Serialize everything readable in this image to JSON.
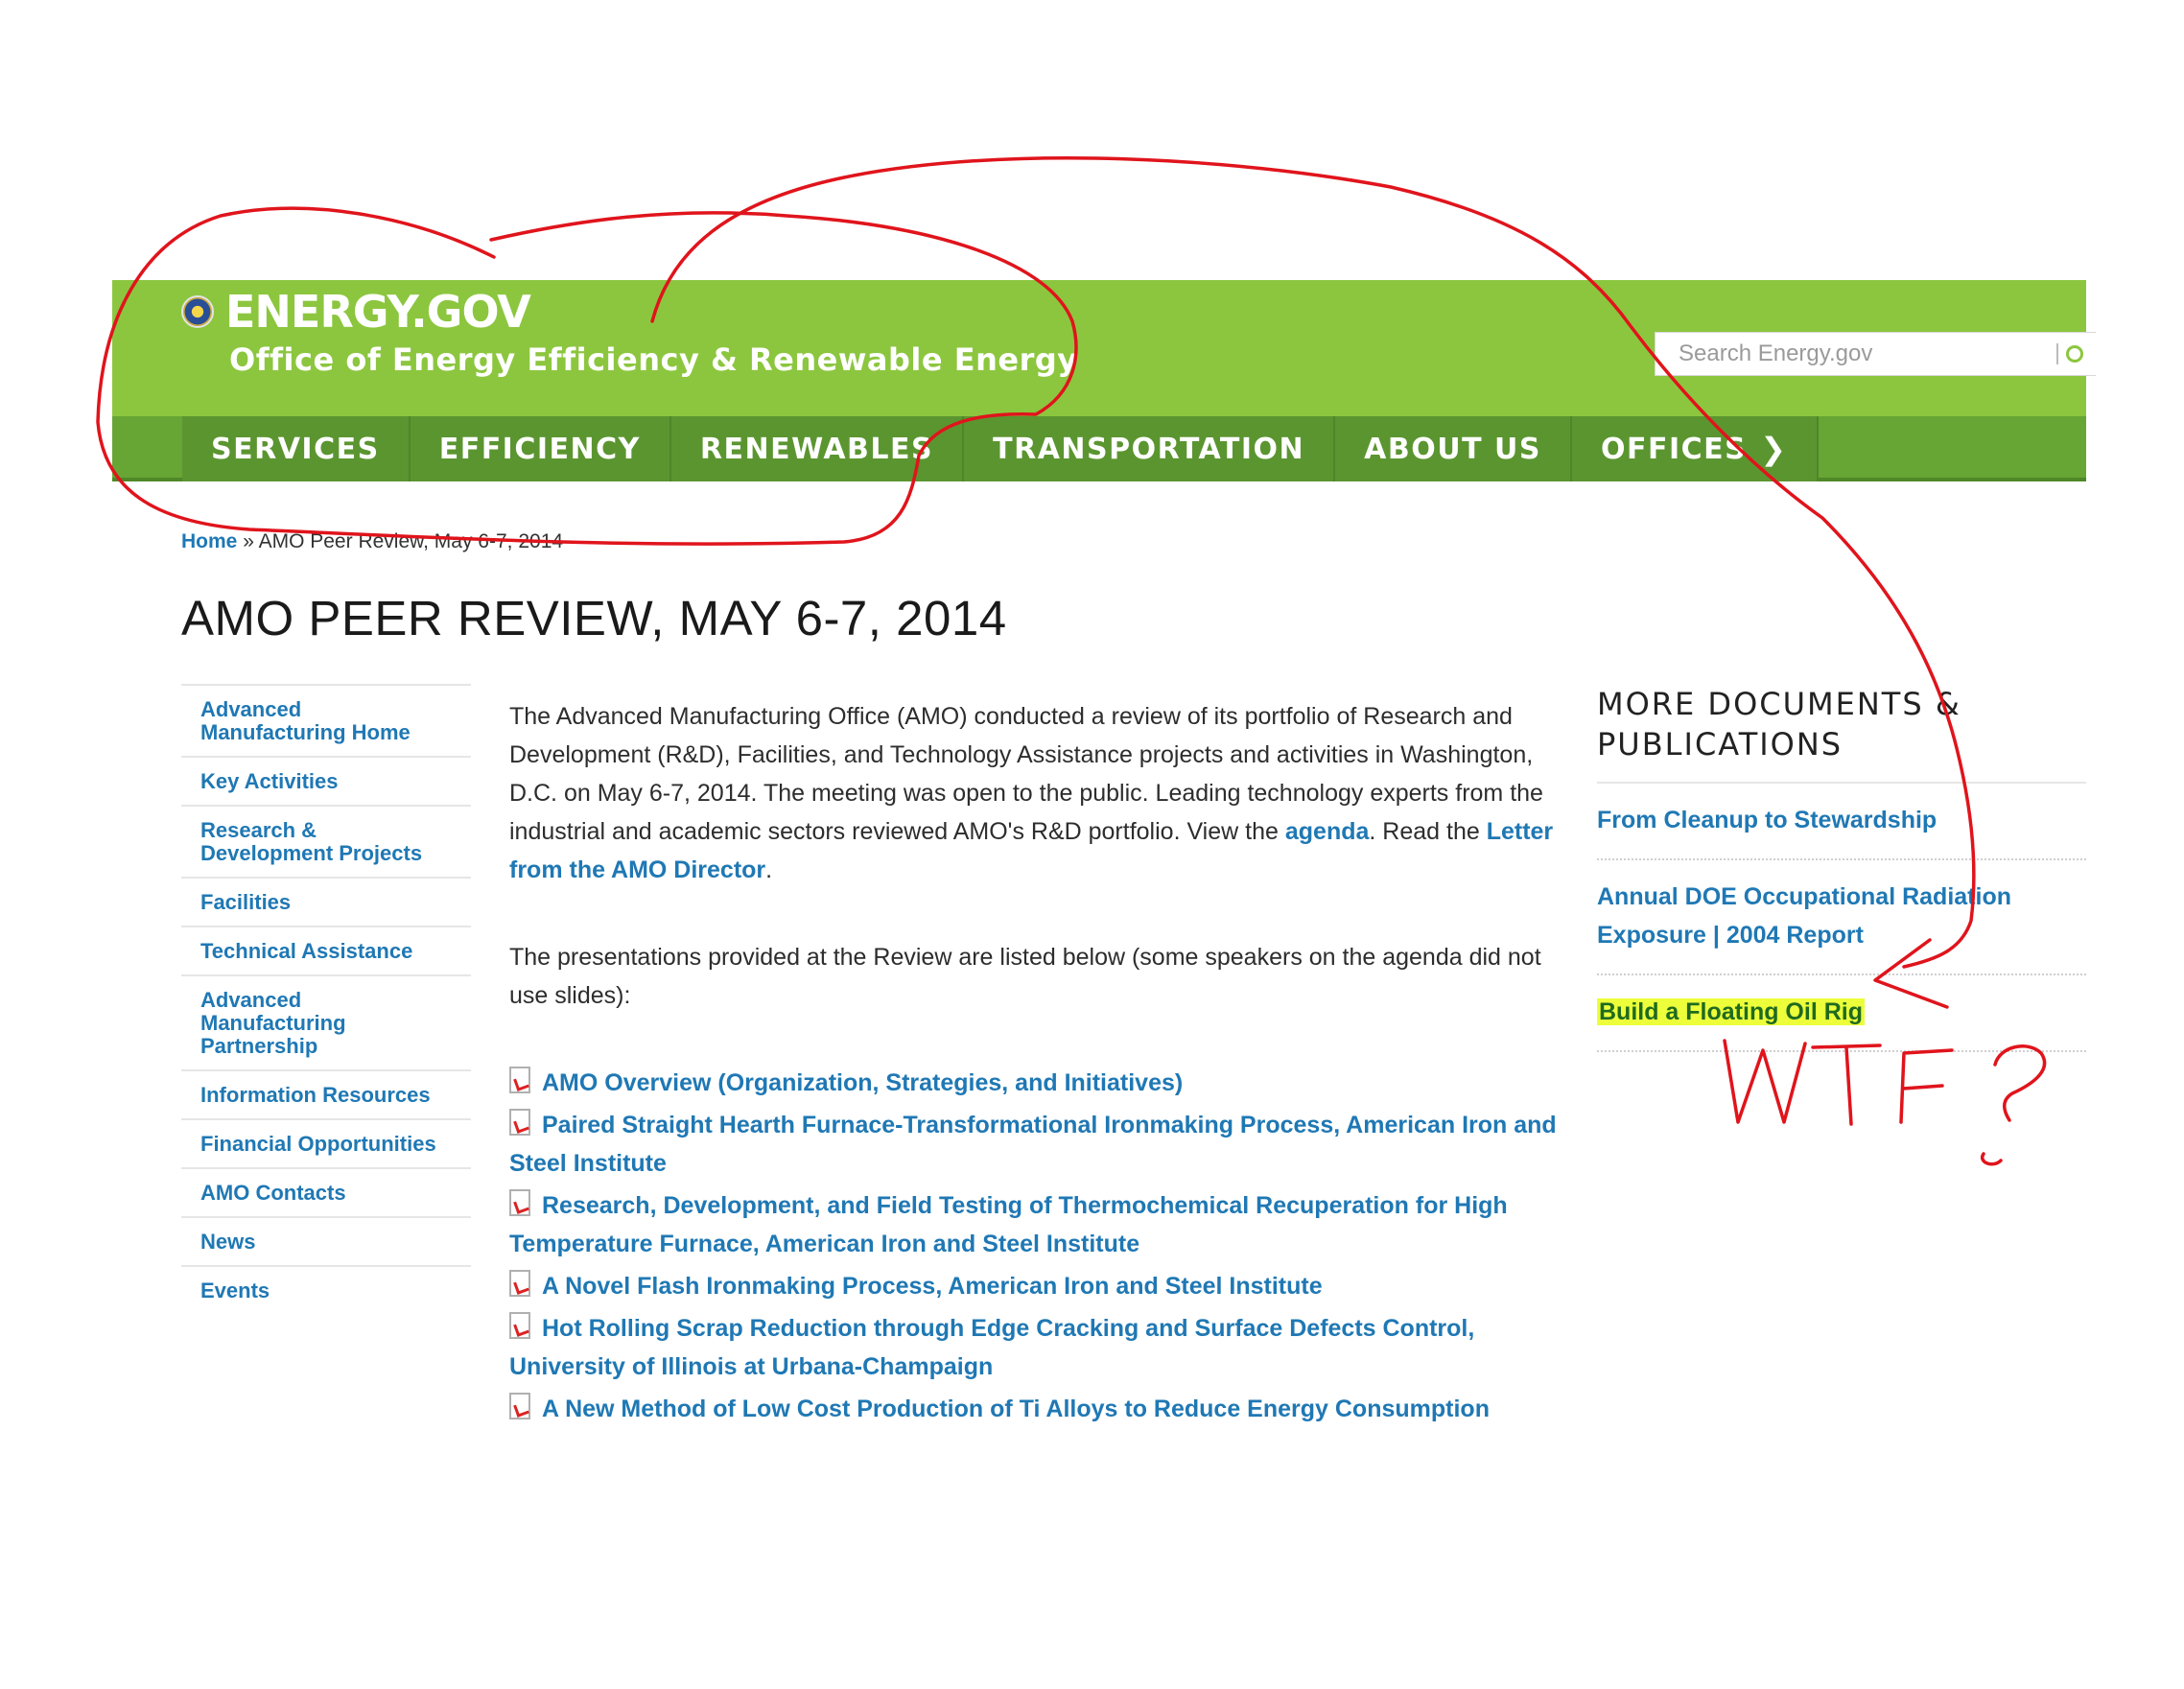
{
  "header": {
    "logo": "ENERGY.GOV",
    "subtitle": "Office of Energy Efficiency & Renewable Energy",
    "search_placeholder": "Search Energy.gov"
  },
  "nav": {
    "items": [
      {
        "label": "SERVICES"
      },
      {
        "label": "EFFICIENCY"
      },
      {
        "label": "RENEWABLES"
      },
      {
        "label": "TRANSPORTATION"
      },
      {
        "label": "ABOUT US"
      },
      {
        "label": "OFFICES"
      }
    ]
  },
  "breadcrumb": {
    "home": "Home",
    "separator": "»",
    "current": "AMO Peer Review, May 6-7, 2014"
  },
  "page_title": "AMO PEER REVIEW, MAY 6-7, 2014",
  "sidebar": {
    "items": [
      {
        "label": "Advanced Manufacturing Home"
      },
      {
        "label": "Key Activities"
      },
      {
        "label": "Research & Development Projects"
      },
      {
        "label": "Facilities"
      },
      {
        "label": "Technical Assistance"
      },
      {
        "label": "Advanced Manufacturing Partnership"
      },
      {
        "label": "Information Resources"
      },
      {
        "label": "Financial Opportunities"
      },
      {
        "label": "AMO Contacts"
      },
      {
        "label": "News"
      },
      {
        "label": "Events"
      }
    ]
  },
  "main": {
    "para1_text": "The Advanced Manufacturing Office (AMO) conducted a review of its portfolio of Research and Development (R&D), Facilities, and Technology Assistance projects and activities in Washington, D.C. on May 6-7, 2014. The meeting was open to the public. Leading technology experts from the industrial and academic sectors reviewed AMO's R&D portfolio. View the",
    "agenda_link": "agenda",
    "read_the": ". Read the",
    "letter_link": "Letter from the AMO Director",
    "period": ".",
    "para2": "The presentations provided at the Review are listed below (some speakers on the agenda did not use slides):",
    "documents": [
      {
        "title": "AMO Overview (Organization, Strategies, and Initiatives)"
      },
      {
        "title": "Paired Straight Hearth Furnace-Transformational Ironmaking Process, American Iron and Steel Institute"
      },
      {
        "title": "Research, Development, and Field Testing of Thermochemical Recuperation for High Temperature Furnace, American Iron and Steel Institute"
      },
      {
        "title": "A Novel Flash Ironmaking Process, American Iron and Steel Institute"
      },
      {
        "title": "Hot Rolling Scrap Reduction through Edge Cracking and Surface Defects Control, University of Illinois at Urbana-Champaign"
      },
      {
        "title": "A New Method of Low Cost Production of Ti Alloys to Reduce Energy Consumption"
      }
    ]
  },
  "right": {
    "heading": "MORE DOCUMENTS & PUBLICATIONS",
    "items": [
      {
        "label": "From Cleanup to Stewardship"
      },
      {
        "label": "Annual DOE Occupational Radiation Exposure | 2004 Report"
      },
      {
        "label": "Build a Floating Oil Rig"
      }
    ]
  },
  "colors": {
    "header_green": "#8cc63f",
    "nav_green": "#5b9530",
    "link_blue": "#1f78b4",
    "annotation_red": "#e0141c",
    "highlight_yellow": "#ecff3a"
  }
}
